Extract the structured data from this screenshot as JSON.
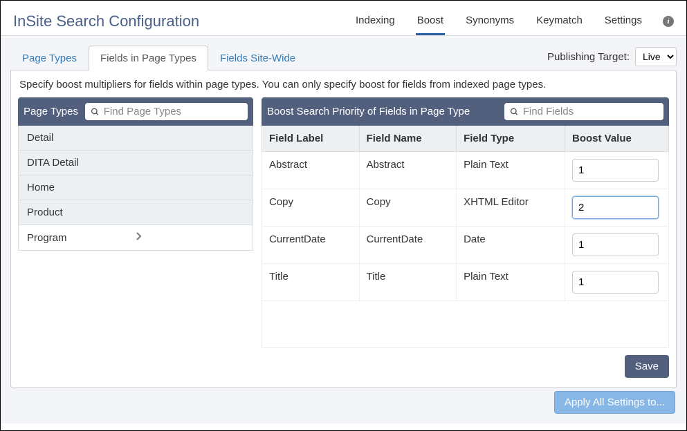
{
  "header": {
    "title": "InSite Search Configuration",
    "nav": [
      "Indexing",
      "Boost",
      "Synonyms",
      "Keymatch",
      "Settings"
    ],
    "info_glyph": "i"
  },
  "tabs": {
    "items": [
      "Page Types",
      "Fields in Page Types",
      "Fields Site-Wide"
    ],
    "pub_target_label": "Publishing Target:",
    "pub_target_value": "Live"
  },
  "panel": {
    "description": "Specify boost multipliers for fields within page types. You can only specify boost for fields from indexed page types.",
    "page_types": {
      "label": "Page Types",
      "search_placeholder": "Find Page Types",
      "items": [
        "Detail",
        "DITA Detail",
        "Home",
        "Product",
        "Program"
      ],
      "selected_index": 4
    },
    "fields": {
      "label": "Boost Search Priority of Fields in Page Type",
      "search_placeholder": "Find Fields",
      "columns": [
        "Field Label",
        "Field Name",
        "Field Type",
        "Boost Value"
      ],
      "rows": [
        {
          "label": "Abstract",
          "name": "Abstract",
          "type": "Plain Text",
          "boost": "1",
          "active": false
        },
        {
          "label": "Copy",
          "name": "Copy",
          "type": "XHTML Editor",
          "boost": "2",
          "active": true
        },
        {
          "label": "CurrentDate",
          "name": "CurrentDate",
          "type": "Date",
          "boost": "1",
          "active": false
        },
        {
          "label": "Title",
          "name": "Title",
          "type": "Plain Text",
          "boost": "1",
          "active": false
        }
      ]
    },
    "save_label": "Save",
    "apply_label": "Apply All Settings to..."
  }
}
